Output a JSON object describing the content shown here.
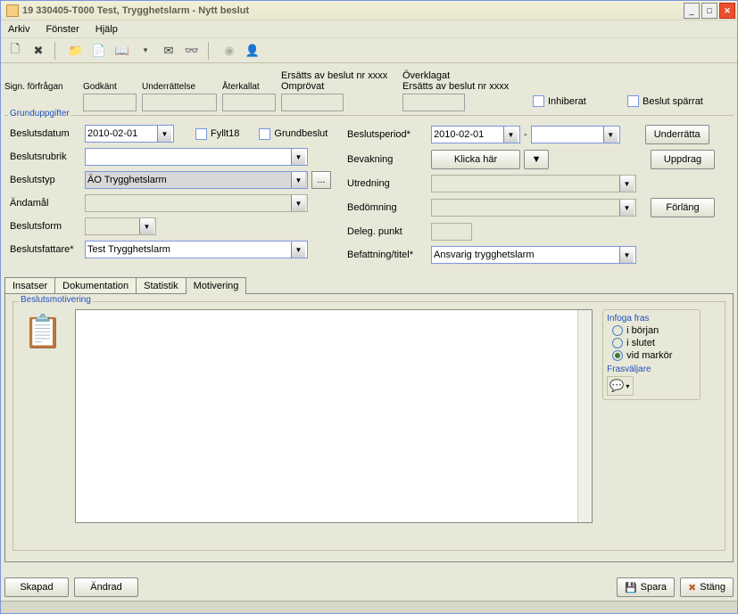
{
  "window": {
    "title": "19 330405-T000  Test, Trygghetslarm   -   Nytt beslut"
  },
  "menu": {
    "arkiv": "Arkiv",
    "fonster": "Fönster",
    "hjalp": "Hjälp"
  },
  "sig": {
    "forfragan": "Sign. förfrågan",
    "godkant": "Godkänt",
    "underrattelse": "Underrättelse",
    "aterkallat": "Återkallat",
    "ersatt_top": "Ersätts av beslut nr xxxx",
    "omprovat": "Omprövat",
    "overklagat": "Överklagat",
    "ersatt2": "Ersätts av beslut nr xxxx",
    "inhiberat": "Inhiberat",
    "sparrat": "Beslut spärrat"
  },
  "grund": {
    "legend": "Grunduppgifter",
    "beslutsdatum_lbl": "Beslutsdatum",
    "beslutsdatum_val": "2010-02-01",
    "fyllt18": "Fyllt18",
    "grundbeslut": "Grundbeslut",
    "beslutsrubrik_lbl": "Beslutsrubrik",
    "beslutstyp_lbl": "Beslutstyp",
    "beslutstyp_val": "ÄO Trygghetslarm",
    "andamal_lbl": "Ändamål",
    "beslutsform_lbl": "Beslutsform",
    "beslutsfattare_lbl": "Beslutsfattare*",
    "beslutsfattare_val": "Test Trygghetslarm",
    "beslutsperiod_lbl": "Beslutsperiod*",
    "beslutsperiod_val": "2010-02-01",
    "dash": "-",
    "bevakning_lbl": "Bevakning",
    "klicka": "Klicka här",
    "utredning_lbl": "Utredning",
    "bedomning_lbl": "Bedömning",
    "deleg_lbl": "Deleg. punkt",
    "befattning_lbl": "Befattning/titel*",
    "befattning_val": "Ansvarig trygghetslarm",
    "underratta_btn": "Underrätta",
    "uppdrag_btn": "Uppdrag",
    "forlang_btn": "Förläng",
    "dots": "..."
  },
  "tabs": {
    "insatser": "Insatser",
    "dokumentation": "Dokumentation",
    "statistik": "Statistik",
    "motivering": "Motivering"
  },
  "motiv": {
    "legend": "Beslutsmotivering",
    "infoga": "Infoga fras",
    "iborjan": "i början",
    "islutet": "i slutet",
    "vidmarkor": "vid markör",
    "frasvaljare": "Frasväljare"
  },
  "bottom": {
    "skapad": "Skapad",
    "andrad": "Ändrad",
    "spara": "Spara",
    "stang": "Stäng"
  }
}
